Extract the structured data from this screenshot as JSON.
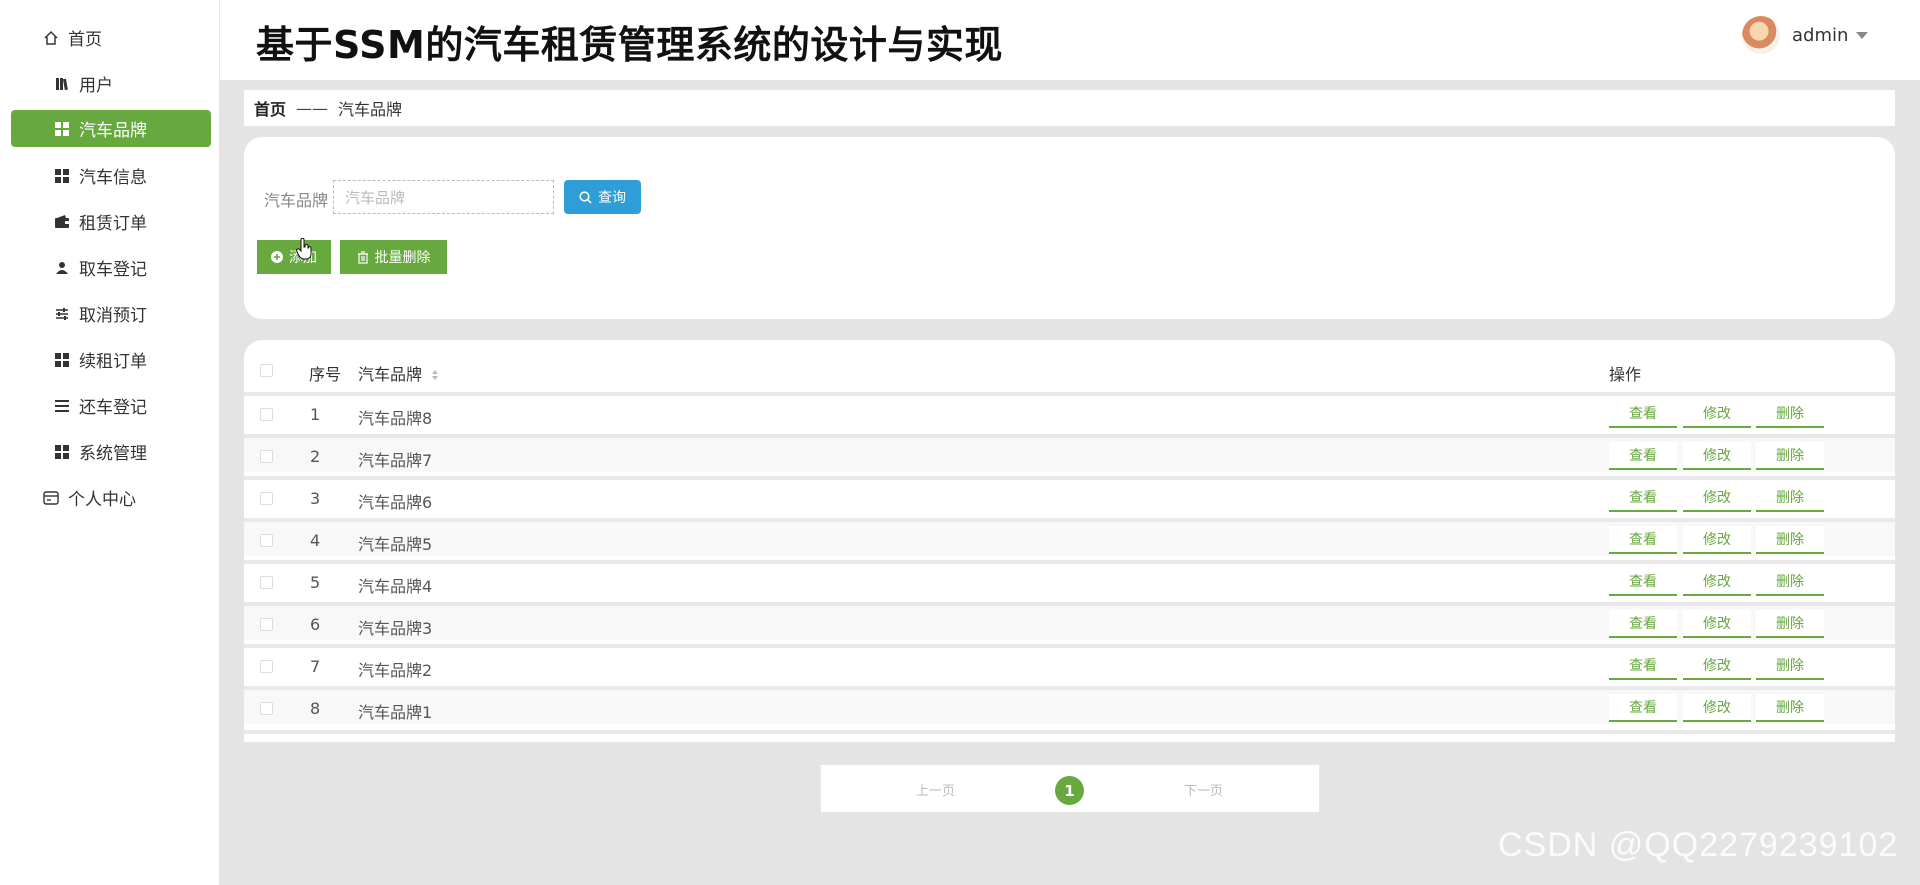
{
  "sidebar": {
    "items": [
      {
        "label": "首页",
        "icon": "home-icon"
      },
      {
        "label": "用户",
        "icon": "book-icon"
      },
      {
        "label": "汽车品牌",
        "icon": "grid-icon",
        "active": true
      },
      {
        "label": "汽车信息",
        "icon": "grid-icon"
      },
      {
        "label": "租赁订单",
        "icon": "wallet-icon"
      },
      {
        "label": "取车登记",
        "icon": "user-icon"
      },
      {
        "label": "取消预订",
        "icon": "sliders-icon"
      },
      {
        "label": "续租订单",
        "icon": "grid-icon"
      },
      {
        "label": "还车登记",
        "icon": "list-icon"
      },
      {
        "label": "系统管理",
        "icon": "grid-icon"
      },
      {
        "label": "个人中心",
        "icon": "card-icon"
      }
    ]
  },
  "header": {
    "title": "基于SSM的汽车租赁管理系统的设计与实现",
    "username": "admin"
  },
  "breadcrumb": {
    "home": "首页",
    "separator": "——",
    "current": "汽车品牌"
  },
  "search": {
    "label": "汽车品牌",
    "placeholder": "汽车品牌",
    "query_button": "查询",
    "add_button": "添加",
    "batch_delete_button": "批量删除"
  },
  "table": {
    "columns": {
      "index": "序号",
      "name": "汽车品牌",
      "actions": "操作"
    },
    "rows": [
      {
        "index": "1",
        "name": "汽车品牌8"
      },
      {
        "index": "2",
        "name": "汽车品牌7"
      },
      {
        "index": "3",
        "name": "汽车品牌6"
      },
      {
        "index": "4",
        "name": "汽车品牌5"
      },
      {
        "index": "5",
        "name": "汽车品牌4"
      },
      {
        "index": "6",
        "name": "汽车品牌3"
      },
      {
        "index": "7",
        "name": "汽车品牌2"
      },
      {
        "index": "8",
        "name": "汽车品牌1"
      }
    ],
    "actions": {
      "view": "查看",
      "edit": "修改",
      "delete": "删除"
    }
  },
  "pagination": {
    "prev": "上一页",
    "current": "1",
    "next": "下一页"
  },
  "watermark": "CSDN @QQ2279239102",
  "colors": {
    "accent": "#67a83f",
    "query": "#2f9dd8"
  }
}
